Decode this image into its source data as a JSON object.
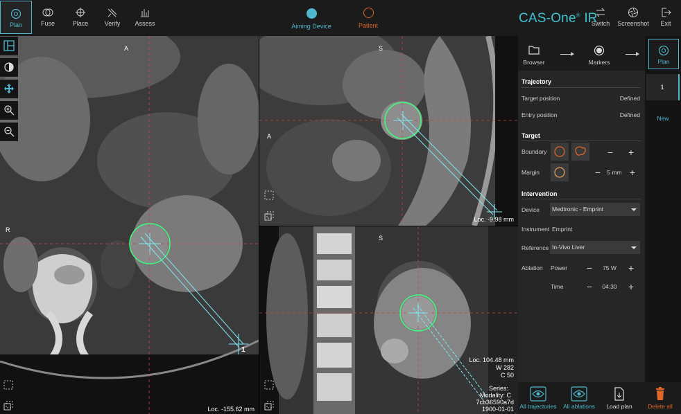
{
  "toolbar": {
    "plan": "Plan",
    "fuse": "Fuse",
    "place": "Place",
    "verify": "Verify",
    "assess": "Assess",
    "switch": "Switch",
    "screenshot": "Screenshot",
    "exit": "Exit"
  },
  "status": {
    "aiming": "Aiming Device",
    "patient": "Patient"
  },
  "brand": "CAS-One",
  "brand_suffix": "IR",
  "viewports": {
    "axial": {
      "top_label": "A",
      "left_label": "R",
      "loc": "Loc. -155.62 mm",
      "traj_num": "1"
    },
    "sagittal": {
      "top_label": "S",
      "left_label": "A",
      "loc": "Loc. -9.98 mm"
    },
    "coronal": {
      "top_label": "S",
      "loc": "Loc. 104.48 mm",
      "w": "W 282",
      "c": "C 50",
      "series": "Series:",
      "modality": "Modality: C",
      "uid": "7cb36590a7d",
      "date": "1900-01-01"
    }
  },
  "workflow": {
    "browser": "Browser",
    "markers": "Markers",
    "plan": "Plan"
  },
  "trajectory": {
    "title": "Trajectory",
    "target_label": "Target position",
    "target_val": "Defined",
    "entry_label": "Entry position",
    "entry_val": "Defined"
  },
  "target": {
    "title": "Target",
    "boundary": "Boundary",
    "margin": "Margin",
    "margin_val": "5 mm"
  },
  "intervention": {
    "title": "Intervention",
    "device_label": "Device",
    "device_val": "Medtronic - Emprint",
    "instrument_label": "Instrument",
    "instrument_val": "Emprint",
    "reference_label": "Reference",
    "reference_val": "In-Vivo Liver",
    "ablation_label": "Ablation",
    "power_label": "Power",
    "power_val": "75 W",
    "time_label": "Time",
    "time_val": "04:30"
  },
  "traj_list": {
    "item1": "1",
    "new": "New"
  },
  "bottom": {
    "all_traj": "All trajectories",
    "all_abl": "All ablations",
    "load": "Load plan",
    "delete": "Delete all"
  },
  "colors": {
    "accent": "#4fb8cc",
    "brand": "#3ec3d2",
    "patient": "#e0652b",
    "delete": "#e0652b",
    "ablation_zone": "#3cff7a",
    "trajectory": "#7fe8f5"
  }
}
